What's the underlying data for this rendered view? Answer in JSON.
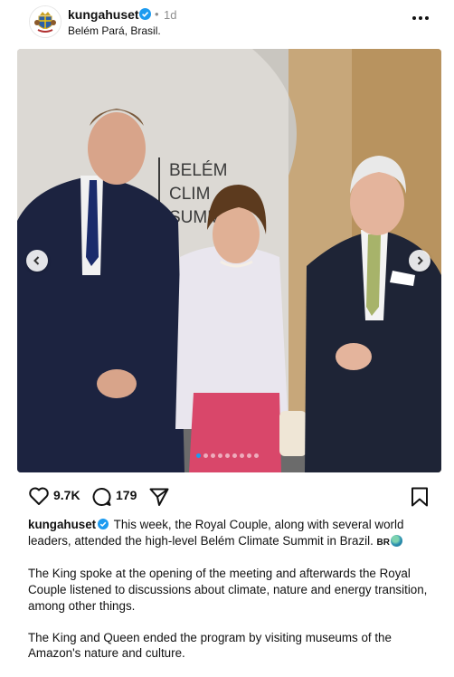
{
  "post": {
    "username": "kungahuset",
    "dot": "•",
    "time": "1d",
    "location": "Belém Pará, Brasil.",
    "more_icon": "more-horizontal-icon"
  },
  "media": {
    "backdrop_text": "BELÉM",
    "backdrop_text2": "CLIM",
    "backdrop_text3": "SUMM",
    "carousel_count": 9,
    "carousel_active": 1
  },
  "actions": {
    "likes": "9.7K",
    "comments": "179"
  },
  "caption": {
    "username": "kungahuset",
    "text1": "This week, the Royal Couple, along with several world leaders, attended the high-level Belém Climate Summit in Brazil.",
    "emoji_text": "BR",
    "text2": "The King spoke at the opening of the meeting and afterwards the Royal Couple listened to discussions about climate, nature and energy transition, among other things.",
    "text3": "The King and Queen ended the program by visiting museums of the Amazon's nature and culture."
  },
  "colors": {
    "accent": "#1c9bf0",
    "muted": "#8e8e8e",
    "verified": "#1d9bf0"
  }
}
